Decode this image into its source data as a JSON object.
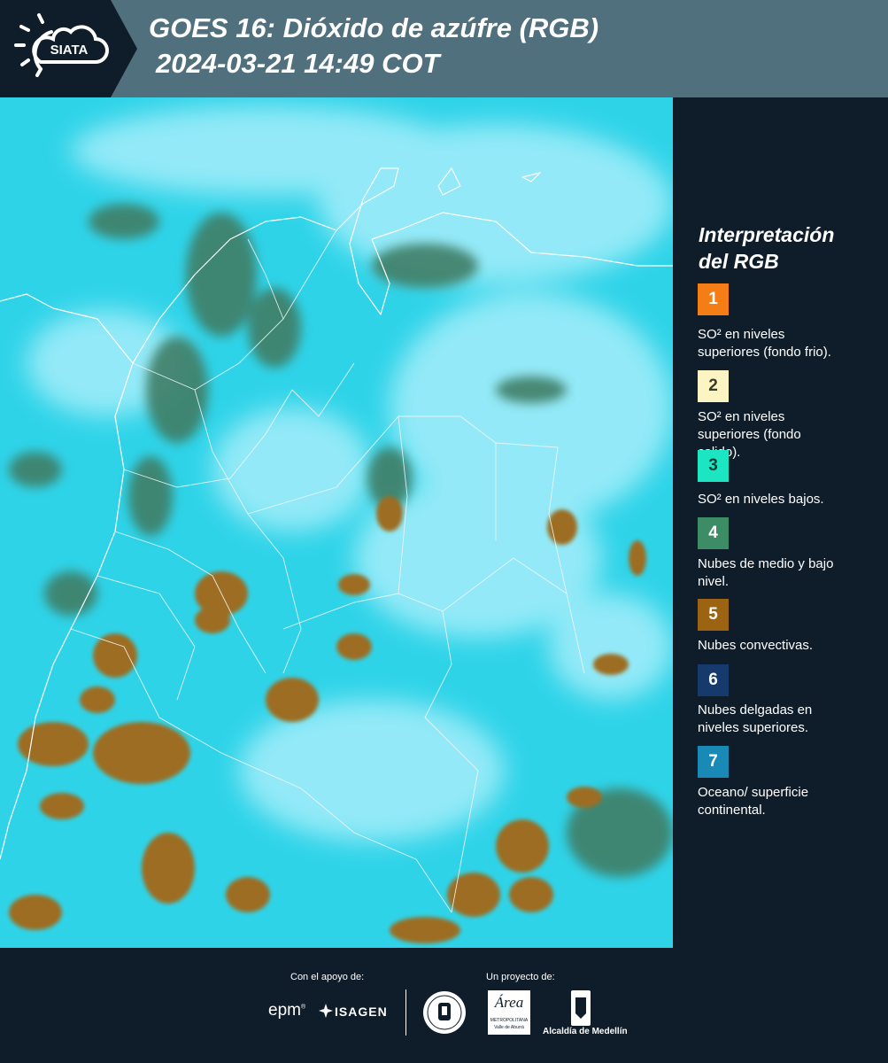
{
  "header": {
    "logo_text": "SIATA",
    "title_line1": "GOES 16: Dióxido de azúfre (RGB)",
    "title_line2": "2024-03-21 14:49 COT"
  },
  "legend": {
    "title_line1": "Interpretación",
    "title_line2": "del RGB",
    "items": [
      {
        "number": "1",
        "color": "#f47d16",
        "line1": "SO² en niveles",
        "line2": "superiores (fondo frio)."
      },
      {
        "number": "2",
        "color": "#fdf4c3",
        "line1": "SO² en niveles",
        "line2": "superiores (fondo",
        "line3": "calido)."
      },
      {
        "number": "3",
        "color": "#1ce6c2",
        "line1": "SO² en niveles bajos."
      },
      {
        "number": "4",
        "color": "#3c8d66",
        "line1": "Nubes de medio y bajo",
        "line2": "nivel."
      },
      {
        "number": "5",
        "color": "#9c6313",
        "line1": "Nubes convectivas."
      },
      {
        "number": "6",
        "color": "#173a6c",
        "line1": "Nubes delgadas en",
        "line2": "niveles superiores."
      },
      {
        "number": "7",
        "color": "#1989b6",
        "line1": "Oceano/ superficie",
        "line2": "continental."
      }
    ]
  },
  "footer": {
    "support_label": "Con el apoyo de:",
    "project_label": "Un proyecto de:",
    "epm": "epm",
    "isagen": "ISAGEN",
    "area_script": "Área",
    "area_line1": "METROPOLITANA",
    "area_line2": "Valle de Aburrá",
    "alcaldia": "Alcaldía de Medellín"
  },
  "colors": {
    "header_bg": "#51707d",
    "panel_bg": "#0f1d2b",
    "sea": "#2fd3e8",
    "cloud_high": "#a5eefa",
    "convective": "#9c6d22",
    "vegetation": "#3f7e66"
  }
}
